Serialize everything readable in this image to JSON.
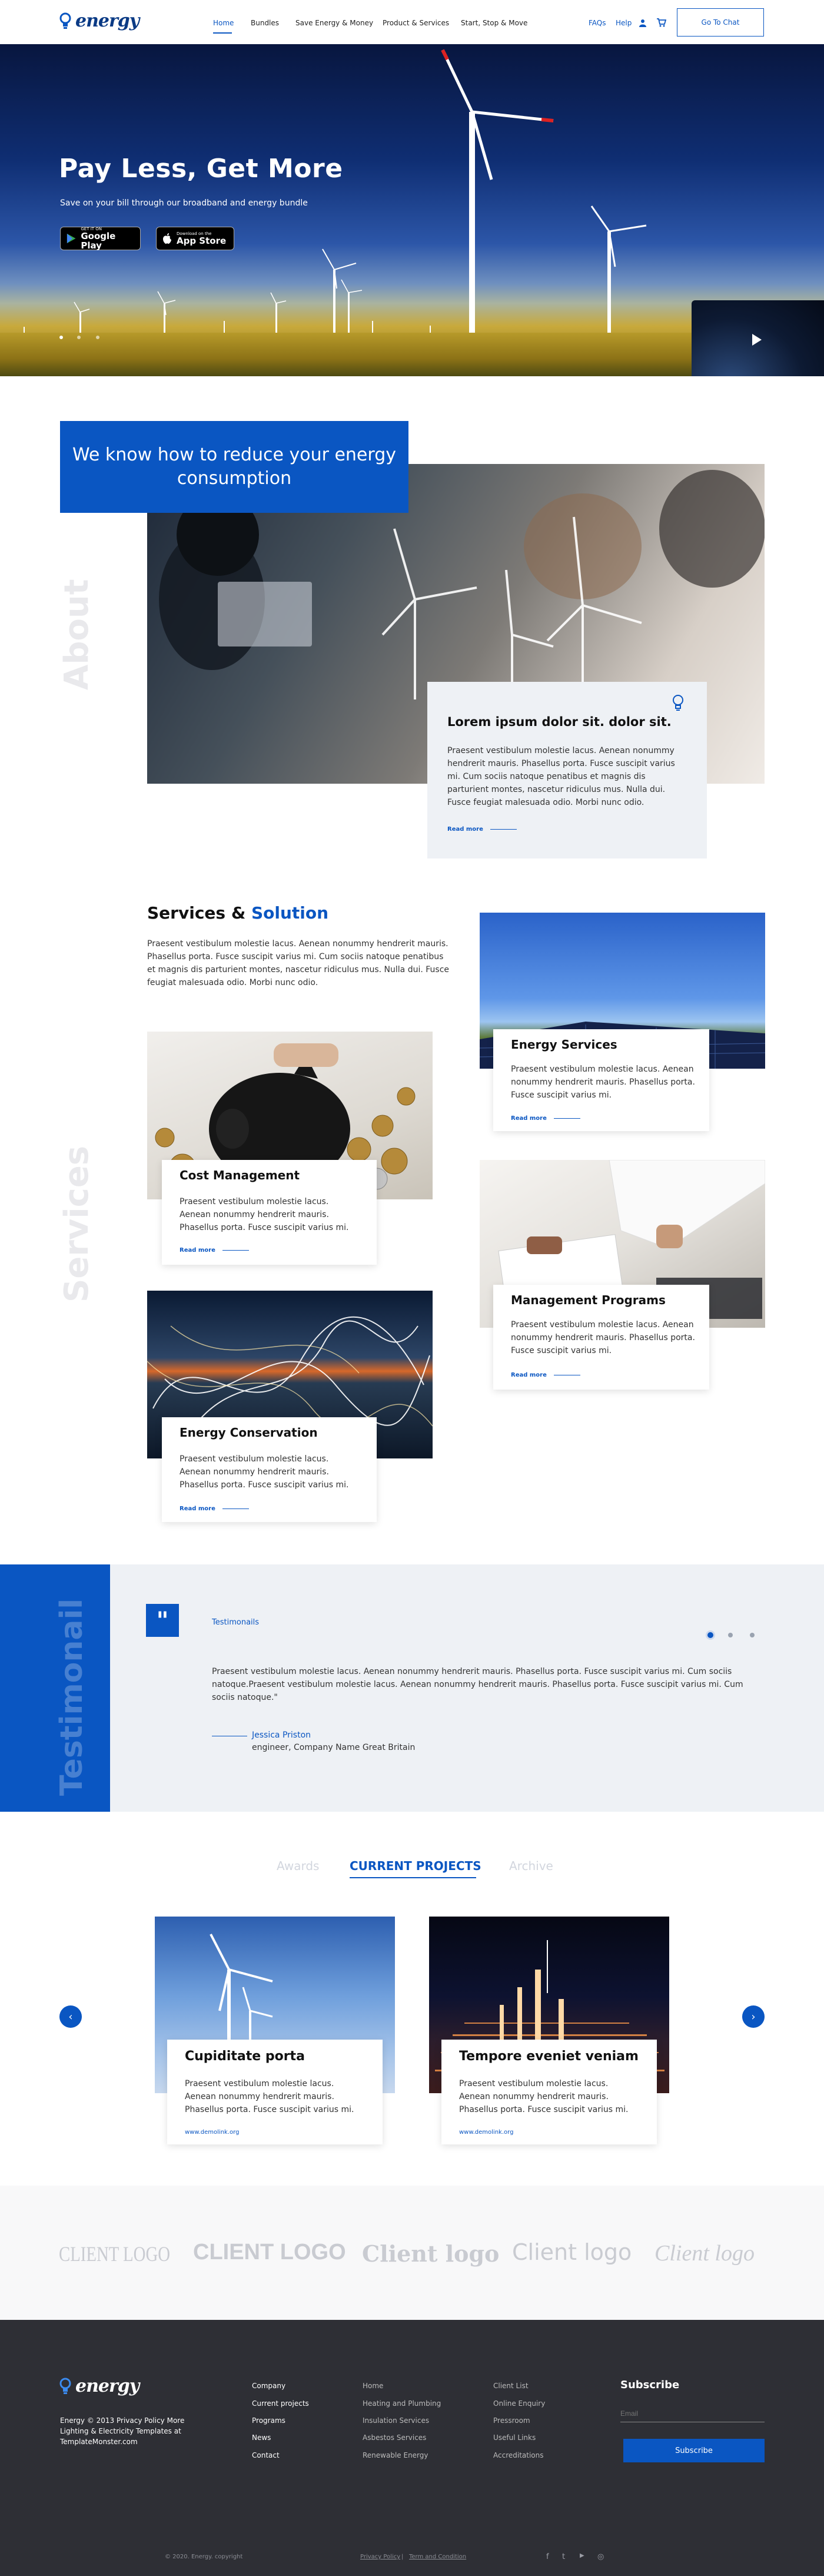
{
  "brand": {
    "name": "energy",
    "accent": "#0a56c2",
    "dark": "#2e2f35"
  },
  "nav": {
    "items": [
      "Home",
      "Bundles",
      "Save Energy & Money",
      "Product & Services",
      "Start, Stop & Move"
    ],
    "active": "Home",
    "faqs": "FAQs",
    "help": "Help",
    "user_icon": "user-icon",
    "cart_icon": "cart-icon",
    "chat_button": "Go To Chat"
  },
  "hero": {
    "title": "Pay Less, Get More",
    "subtitle": "Save on your bill through our broadband and energy bundle",
    "google_small": "GET IT ON",
    "google_big": "Google Play",
    "apple_small": "Download on the",
    "apple_big": "App Store",
    "slide_count": 3,
    "video_icon": "play-icon"
  },
  "about": {
    "vertical_label": "About",
    "title": "We know how to reduce your energy consumption",
    "card_icon": "bulb-icon",
    "card_title": "Lorem ipsum dolor sit. dolor sit.",
    "card_text": "Praesent vestibulum molestie lacus. Aenean nonummy hendrerit mauris. Phasellus porta. Fusce suscipit varius mi. Cum sociis natoque penatibus et magnis dis parturient montes, nascetur ridiculus mus. Nulla dui. Fusce feugiat malesuada odio. Morbi nunc odio.",
    "read_more": "Read more"
  },
  "services": {
    "vertical_label": "Services",
    "title_a": "Services &",
    "title_b": "Solution",
    "intro": "Praesent vestibulum molestie lacus. Aenean nonummy hendrerit mauris. Phasellus porta. Fusce suscipit varius mi. Cum sociis natoque penatibus et magnis dis parturient montes, nascetur ridiculus mus. Nulla dui. Fusce feugiat malesuada odio. Morbi nunc odio.",
    "cards": [
      {
        "title": "Energy Services",
        "text": "Praesent vestibulum molestie lacus. Aenean nonummy hendrerit mauris. Phasellus porta. Fusce suscipit varius mi.",
        "link": "Read more"
      },
      {
        "title": "Cost Management",
        "text": "Praesent vestibulum molestie lacus. Aenean nonummy hendrerit mauris. Phasellus porta. Fusce suscipit varius mi.",
        "link": "Read more"
      },
      {
        "title": "Management Programs",
        "text": "Praesent vestibulum molestie lacus. Aenean nonummy hendrerit mauris. Phasellus porta. Fusce suscipit varius mi.",
        "link": "Read more"
      },
      {
        "title": "Energy Conservation",
        "text": "Praesent vestibulum molestie lacus. Aenean nonummy hendrerit mauris. Phasellus porta. Fusce suscipit varius mi.",
        "link": "Read more"
      }
    ]
  },
  "testimonials": {
    "vertical_label": "Testimonail",
    "label": "Testimonails",
    "quote_icon": "quote-icon",
    "text": "Praesent vestibulum molestie lacus. Aenean nonummy hendrerit mauris. Phasellus porta. Fusce suscipit varius mi. Cum sociis natoque.Praesent vestibulum molestie lacus. Aenean nonummy hendrerit mauris. Phasellus porta. Fusce suscipit varius mi. Cum sociis natoque.\"",
    "author": "Jessica Priston",
    "role": "engineer, Company Name Great Britain",
    "slides": 3,
    "active_slide": 1
  },
  "projects": {
    "tabs": [
      "Awards",
      "CURRENT PROJECTS",
      "Archive"
    ],
    "active_tab": "CURRENT PROJECTS",
    "prev_icon": "chevron-left-icon",
    "next_icon": "chevron-right-icon",
    "items": [
      {
        "title": "Cupiditate porta",
        "text": "Praesent vestibulum molestie lacus. Aenean nonummy hendrerit mauris. Phasellus porta. Fusce suscipit varius mi.",
        "link": "www.demolink.org"
      },
      {
        "title": "Tempore eveniet veniam",
        "text": "Praesent vestibulum molestie lacus. Aenean nonummy hendrerit mauris. Phasellus porta. Fusce suscipit varius mi.",
        "link": "www.demolink.org"
      }
    ]
  },
  "clients": [
    "CLIENT LOGO",
    "CLIENT LOGO",
    "Client logo",
    "Client logo",
    "Client logo"
  ],
  "footer": {
    "about": "Energy © 2013 Privacy Policy More Lighting & Electricity Templates at TemplateMonster.com",
    "col1": [
      "Company",
      "Current projects",
      "Programs",
      "News",
      "Contact"
    ],
    "col2": [
      "Home",
      "Heating and Plumbing",
      "Insulation Services",
      "Asbestos Services",
      "Renewable Energy"
    ],
    "col3": [
      "Client List",
      "Online Enquiry",
      "Pressroom",
      "Useful Links",
      "Accreditations"
    ],
    "subscribe_title": "Subscribe",
    "email_placeholder": "Email",
    "subscribe_button": "Subscribe",
    "copyright": "© 2020. Energy. copyright",
    "privacy": "Privacy Policy",
    "sep": "|",
    "terms": "Term and Condition",
    "social": [
      "f",
      "t",
      "▶",
      "◎"
    ]
  }
}
